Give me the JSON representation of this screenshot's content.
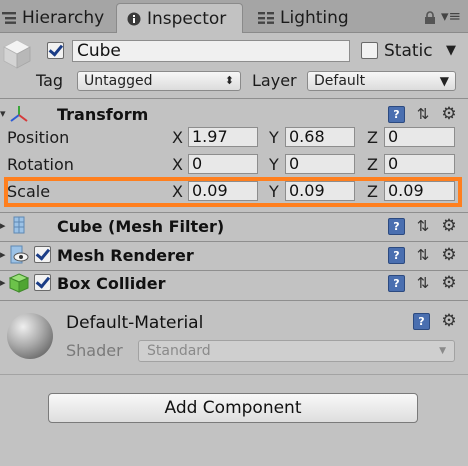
{
  "tabs": [
    {
      "label": "Hierarchy",
      "icon": "hierarchy-icon"
    },
    {
      "label": "Inspector",
      "icon": "info-icon"
    },
    {
      "label": "Lighting",
      "icon": "lighting-icon"
    }
  ],
  "object": {
    "name": "Cube",
    "active": true,
    "static_label": "Static",
    "static": false,
    "tag_label": "Tag",
    "tag_value": "Untagged",
    "layer_label": "Layer",
    "layer_value": "Default"
  },
  "transform": {
    "title": "Transform",
    "rows": [
      {
        "label": "Position",
        "x": "1.97",
        "y": "0.68",
        "z": "0"
      },
      {
        "label": "Rotation",
        "x": "0",
        "y": "0",
        "z": "0"
      },
      {
        "label": "Scale",
        "x": "0.09",
        "y": "0.09",
        "z": "0.09"
      }
    ],
    "axis_x": "X",
    "axis_y": "Y",
    "axis_z": "Z"
  },
  "components": [
    {
      "title": "Cube (Mesh Filter)",
      "has_checkbox": false,
      "enabled": null
    },
    {
      "title": "Mesh Renderer",
      "has_checkbox": true,
      "enabled": true
    },
    {
      "title": "Box Collider",
      "has_checkbox": true,
      "enabled": true
    }
  ],
  "material": {
    "name": "Default-Material",
    "shader_label": "Shader",
    "shader_value": "Standard"
  },
  "add_component_label": "Add Component",
  "colors": {
    "highlight": "#ff7f1e",
    "panel": "#c2c2c2"
  }
}
